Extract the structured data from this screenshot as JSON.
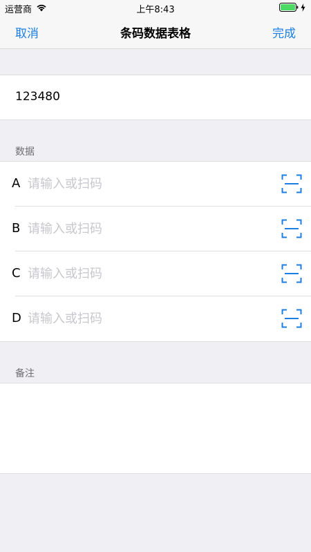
{
  "status_bar": {
    "carrier": "运营商",
    "time": "上午8:43",
    "battery_color": "#4cd964"
  },
  "nav": {
    "cancel_label": "取消",
    "title": "条码数据表格",
    "done_label": "完成",
    "accent_color": "#1a7ee6"
  },
  "barcode": {
    "value": "123480"
  },
  "data_section": {
    "header": "数据",
    "rows": [
      {
        "label": "A",
        "placeholder": "请输入或扫码",
        "icon": "scan-icon"
      },
      {
        "label": "B",
        "placeholder": "请输入或扫码",
        "icon": "scan-icon"
      },
      {
        "label": "C",
        "placeholder": "请输入或扫码",
        "icon": "scan-icon"
      },
      {
        "label": "D",
        "placeholder": "请输入或扫码",
        "icon": "scan-icon"
      }
    ]
  },
  "notes_section": {
    "header": "备注",
    "value": ""
  }
}
